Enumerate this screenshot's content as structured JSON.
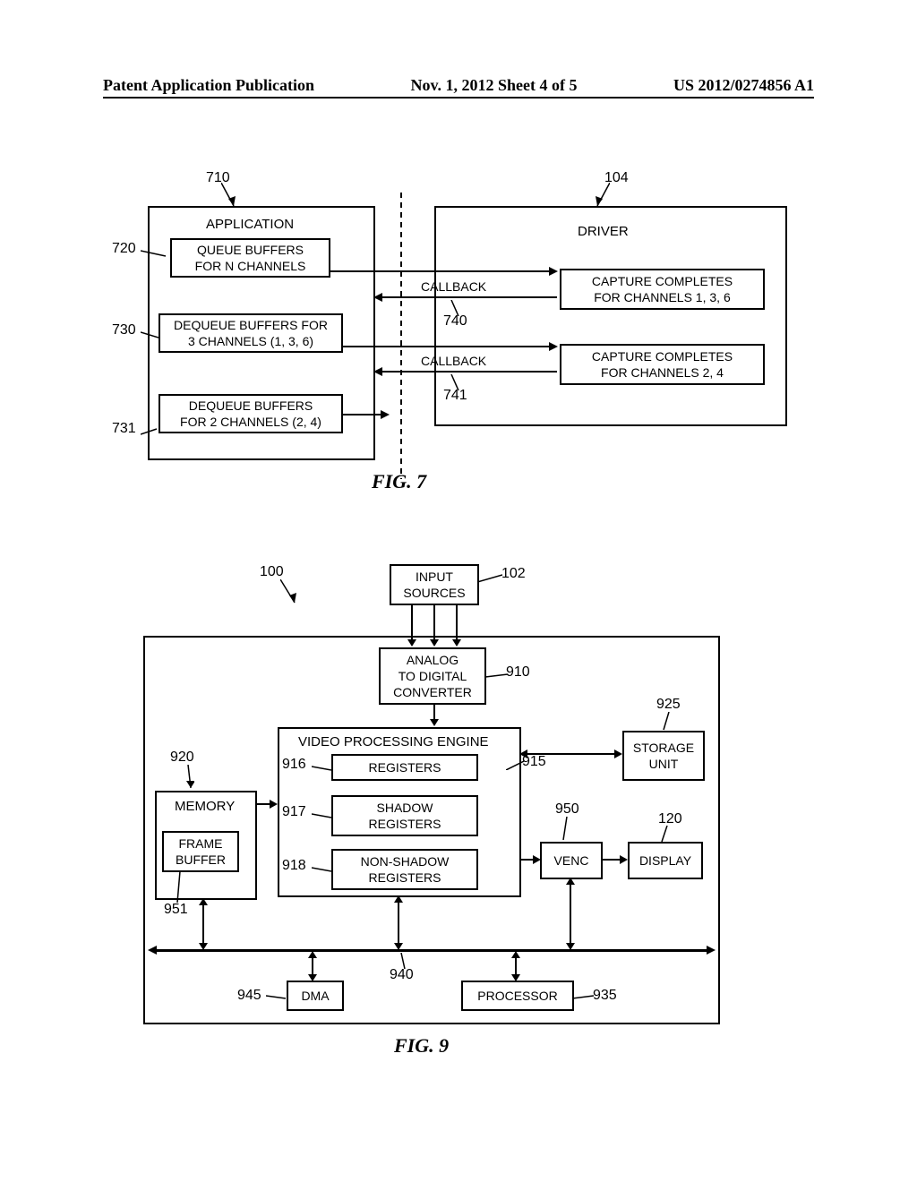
{
  "header": {
    "left": "Patent Application Publication",
    "center": "Nov. 1, 2012   Sheet 4 of 5",
    "right": "US 2012/0274856 A1"
  },
  "fig7": {
    "ref710": "710",
    "ref104": "104",
    "ref720": "720",
    "ref730": "730",
    "ref731": "731",
    "ref740": "740",
    "ref741": "741",
    "application": "APPLICATION",
    "driver": "DRIVER",
    "queue_buffers_line1": "QUEUE BUFFERS",
    "queue_buffers_line2": "FOR N CHANNELS",
    "dequeue1_line1": "DEQUEUE BUFFERS FOR",
    "dequeue1_line2": "3 CHANNELS (1, 3, 6)",
    "dequeue2_line1": "DEQUEUE BUFFERS",
    "dequeue2_line2": "FOR 2 CHANNELS (2, 4)",
    "callback": "CALLBACK",
    "capture1_line1": "CAPTURE COMPLETES",
    "capture1_line2": "FOR CHANNELS 1, 3, 6",
    "capture2_line1": "CAPTURE COMPLETES",
    "capture2_line2": "FOR CHANNELS 2, 4",
    "caption": "FIG. 7"
  },
  "fig9": {
    "ref100": "100",
    "ref102": "102",
    "ref910": "910",
    "ref920": "920",
    "ref925": "925",
    "ref915": "915",
    "ref916": "916",
    "ref917": "917",
    "ref918": "918",
    "ref935": "935",
    "ref940": "940",
    "ref945": "945",
    "ref950": "950",
    "ref951": "951",
    "ref120": "120",
    "input_sources": "INPUT\nSOURCES",
    "adc_line1": "ANALOG",
    "adc_line2": "TO DIGITAL",
    "adc_line3": "CONVERTER",
    "vpe": "VIDEO PROCESSING ENGINE",
    "registers": "REGISTERS",
    "shadow_line1": "SHADOW",
    "shadow_line2": "REGISTERS",
    "nonshadow_line1": "NON-SHADOW",
    "nonshadow_line2": "REGISTERS",
    "memory": "MEMORY",
    "frame_buffer_line1": "FRAME",
    "frame_buffer_line2": "BUFFER",
    "storage_line1": "STORAGE",
    "storage_line2": "UNIT",
    "venc": "VENC",
    "display": "DISPLAY",
    "dma": "DMA",
    "processor": "PROCESSOR",
    "caption": "FIG. 9"
  }
}
